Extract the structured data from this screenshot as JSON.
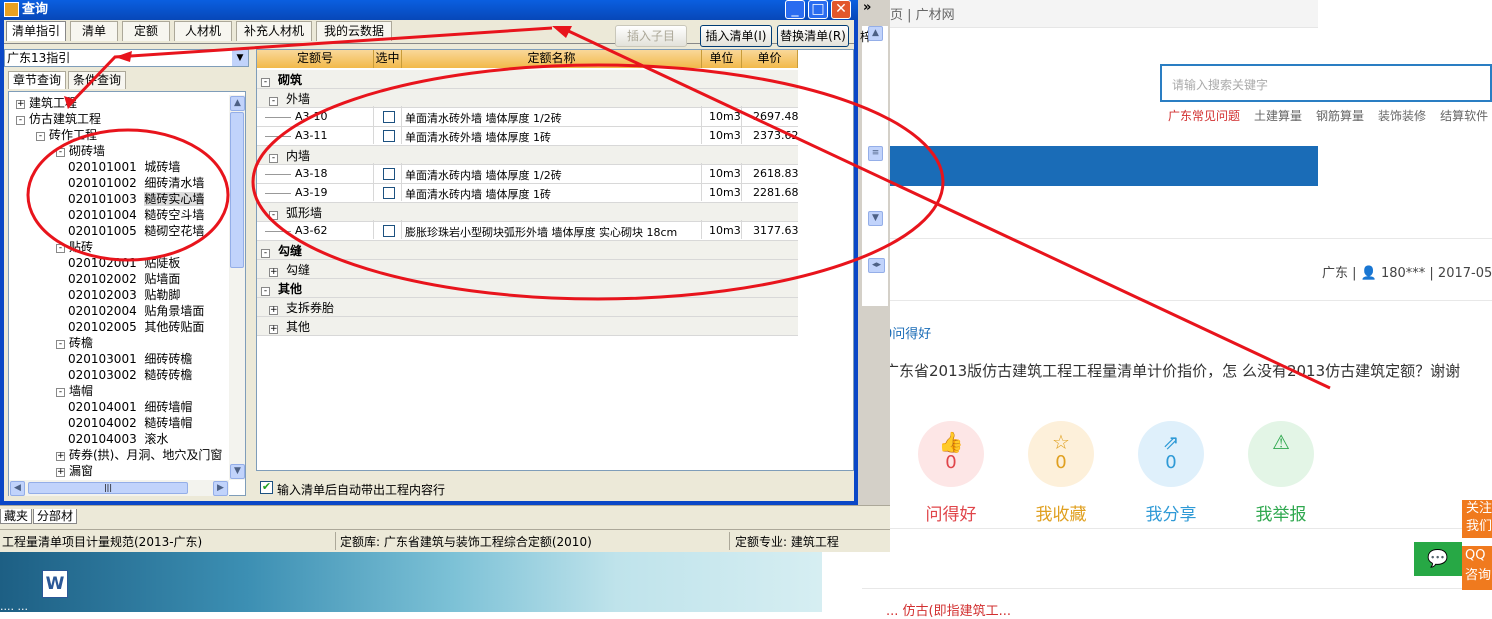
{
  "web": {
    "top_nav": "页  |   广材网",
    "search_placeholder": "请输入搜索关键字",
    "tags": [
      "广东常见问题",
      "土建算量",
      "钢筋算量",
      "装饰装修",
      "结算软件"
    ],
    "meta": "广东 | 👤 180*** | 2017-05-",
    "wendehao_link": "0问得好",
    "question": "广东省2013版仿古建筑工程工程量清单计价指价，怎 么没有2013仿古建筑定额？谢谢",
    "actions": [
      {
        "icon": "thumbs-up-icon",
        "glyph": "👍",
        "count": "0",
        "label": "问得好",
        "color": "#e0454a",
        "bg": "#fde6e6"
      },
      {
        "icon": "star-icon",
        "glyph": "☆",
        "count": "0",
        "label": "我收藏",
        "color": "#e0a020",
        "bg": "#fdf0da"
      },
      {
        "icon": "share-icon",
        "glyph": "⇗",
        "count": "0",
        "label": "我分享",
        "color": "#2f9ad6",
        "bg": "#dff0fb"
      },
      {
        "icon": "warning-icon",
        "glyph": "⚠",
        "count": "",
        "label": "我举报",
        "color": "#2fa84f",
        "bg": "#e3f5e6"
      }
    ],
    "follow_label": "关注我们",
    "qq_label": "QQ咨询",
    "chat_icon": "chat-icon",
    "bottom_red": "... 仿古(即指建筑工..."
  },
  "desktop": {
    "icon_label": "W",
    "bottom_text": "....  ..."
  },
  "app": {
    "bottom_tabs": [
      "藏夹",
      "分部材"
    ],
    "status": {
      "spec": "工程量清单项目计量规范(2013-广东)",
      "quota_lib": "定额库: 广东省建筑与装饰工程综合定额(2010)",
      "major": "定额专业: 建筑工程"
    },
    "right_strip_text": "梓"
  },
  "dialog": {
    "title": "查询",
    "tabs": [
      "清单指引",
      "清单",
      "定额",
      "人材机",
      "补充人材机",
      "我的云数据"
    ],
    "buttons": {
      "insert_child": "插入子目",
      "insert_list": "插入清单(I)",
      "replace_list": "替换清单(R)"
    },
    "combo_value": "广东13指引",
    "subtabs": [
      "章节查询",
      "条件查询"
    ],
    "tree": [
      {
        "level": 0,
        "pm": "+",
        "text": "建筑工程"
      },
      {
        "level": 0,
        "pm": "-",
        "text": "仿古建筑工程"
      },
      {
        "level": 1,
        "pm": "-",
        "text": "砖作工程"
      },
      {
        "level": 2,
        "pm": "-",
        "text": "砌砖墙"
      },
      {
        "level": 3,
        "code": "020101001",
        "text": "城砖墙"
      },
      {
        "level": 3,
        "code": "020101002",
        "text": "细砖清水墙"
      },
      {
        "level": 3,
        "code": "020101003",
        "text": "糙砖实心墙",
        "selected": true
      },
      {
        "level": 3,
        "code": "020101004",
        "text": "糙砖空斗墙"
      },
      {
        "level": 3,
        "code": "020101005",
        "text": "糙砌空花墙"
      },
      {
        "level": 2,
        "pm": "-",
        "text": "贴砖"
      },
      {
        "level": 3,
        "code": "020102001",
        "text": "贴陡板"
      },
      {
        "level": 3,
        "code": "020102002",
        "text": "贴墙面"
      },
      {
        "level": 3,
        "code": "020102003",
        "text": "贴勒脚"
      },
      {
        "level": 3,
        "code": "020102004",
        "text": "贴角景墙面"
      },
      {
        "level": 3,
        "code": "020102005",
        "text": "其他砖贴面"
      },
      {
        "level": 2,
        "pm": "-",
        "text": "砖檐"
      },
      {
        "level": 3,
        "code": "020103001",
        "text": "细砖砖檐"
      },
      {
        "level": 3,
        "code": "020103002",
        "text": "糙砖砖檐"
      },
      {
        "level": 2,
        "pm": "-",
        "text": "墙帽"
      },
      {
        "level": 3,
        "code": "020104001",
        "text": "细砖墙帽"
      },
      {
        "level": 3,
        "code": "020104002",
        "text": "糙砖墙帽"
      },
      {
        "level": 3,
        "code": "020104003",
        "text": "滚水"
      },
      {
        "level": 2,
        "pm": "+",
        "text": "砖券(拱)、月洞、地穴及门窗"
      },
      {
        "level": 2,
        "pm": "+",
        "text": "漏窗"
      }
    ],
    "grid_headers": [
      "定额号",
      "选中",
      "定额名称",
      "单位",
      "单价"
    ],
    "grid_rows": [
      {
        "type": "grp0",
        "pm": "-",
        "text": "砌筑"
      },
      {
        "type": "grp1",
        "pm": "-",
        "text": "外墙"
      },
      {
        "type": "item",
        "code": "A3-10",
        "name": "单面清水砖外墙 墙体厚度 1/2砖",
        "unit": "10m3",
        "price": "2697.48"
      },
      {
        "type": "item",
        "code": "A3-11",
        "name": "单面清水砖外墙 墙体厚度 1砖",
        "unit": "10m3",
        "price": "2373.62"
      },
      {
        "type": "grp1",
        "pm": "-",
        "text": "内墙"
      },
      {
        "type": "item",
        "code": "A3-18",
        "name": "单面清水砖内墙 墙体厚度 1/2砖",
        "unit": "10m3",
        "price": "2618.83"
      },
      {
        "type": "item",
        "code": "A3-19",
        "name": "单面清水砖内墙 墙体厚度 1砖",
        "unit": "10m3",
        "price": "2281.68"
      },
      {
        "type": "grp1",
        "pm": "-",
        "text": "弧形墙"
      },
      {
        "type": "item",
        "code": "A3-62",
        "name": "膨胀珍珠岩小型砌块弧形外墙 墙体厚度 实心砌块 18cm",
        "unit": "10m3",
        "price": "3177.63"
      },
      {
        "type": "grp0",
        "pm": "-",
        "text": "勾缝"
      },
      {
        "type": "grp1",
        "pm": "+",
        "text": "勾缝"
      },
      {
        "type": "grp0",
        "pm": "-",
        "text": "其他"
      },
      {
        "type": "grp1",
        "pm": "+",
        "text": "支拆券胎"
      },
      {
        "type": "grp1",
        "pm": "+",
        "text": "其他"
      }
    ],
    "auto_check_label": "输入清单后自动带出工程内容行",
    "auto_checked": true
  },
  "annotation_color": "#e8141c"
}
